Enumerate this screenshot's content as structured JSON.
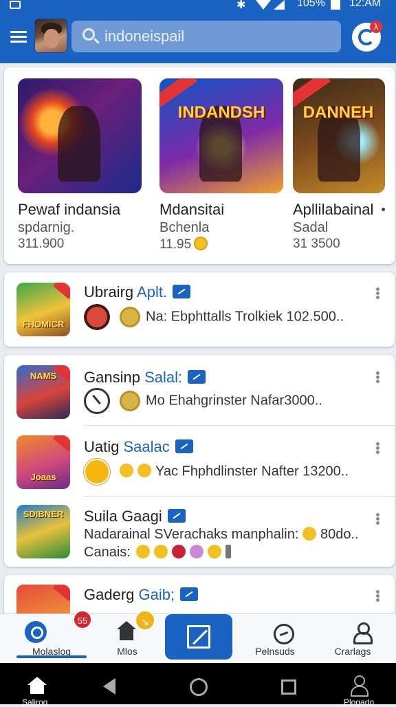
{
  "status": {
    "battery": "105%",
    "time": "12:AM"
  },
  "header": {
    "search_placeholder": "indoneispail",
    "notif_badge": "λ"
  },
  "featured": [
    {
      "art_text": "",
      "name": "Pewaf indansia",
      "sub": "spdarnig.",
      "num": "311.900"
    },
    {
      "art_text": "INDANDSH",
      "name": "Mdansitai",
      "sub": "Bchenla",
      "num": "11.95"
    },
    {
      "art_text": "DANNEH",
      "name": "Apllilabainal",
      "sub": "Sadal",
      "num": "31 3500"
    }
  ],
  "list": [
    {
      "title": "Ubrairg",
      "title_accent": "Aplt.",
      "thumb_label": "FHOMICR",
      "line": "Na: Ebphttalls Trolkiek 102.500.."
    },
    {
      "title": "Gansinp",
      "title_accent": "Salal:",
      "thumb_label": "NAMS",
      "line": "Mo Ehahgrinster Nafar3000.."
    },
    {
      "title": "Uatig",
      "title_accent": "Saalac",
      "thumb_label": "Joaas",
      "line": "Yac Fhphdlinster Nafter 13200.."
    },
    {
      "title": "Suila Gaagi",
      "title_accent": "",
      "thumb_label": "SDIBNER",
      "line": "Nadarainal SVerachaks manphalin:",
      "line_tail": "80do..",
      "line2": "Canais:"
    },
    {
      "title": "Gaderg",
      "title_accent": "Gaib;",
      "thumb_label": "",
      "line": ""
    }
  ],
  "bottom_nav": {
    "items": [
      "Molaslog",
      "Mlos",
      "",
      "Pelnsuds",
      "Crarlags"
    ],
    "badge_red": "55",
    "badge_yellow": "↘"
  },
  "system_nav": {
    "home_label": "Salirog",
    "profile_label": "Plogado"
  },
  "colors": {
    "primary": "#1a63c2",
    "badge_red": "#d8232a",
    "coin": "#f2c023"
  }
}
